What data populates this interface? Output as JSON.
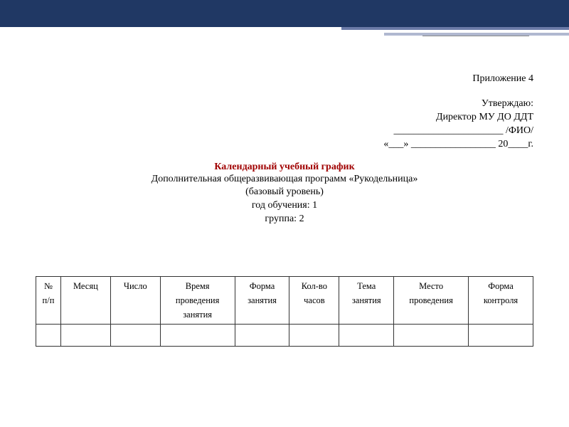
{
  "header": {
    "appendix": "Приложение 4"
  },
  "approve": {
    "line1": "Утверждаю:",
    "line2": "Директор МУ ДО ДДТ",
    "line3": "______________________ /ФИО/",
    "line4": "«___»  _________________ 20____г."
  },
  "title": {
    "main": "Календарный учебный график",
    "program": "Дополнительная общеразвивающая программ «Рукодельница»",
    "level": "(базовый уровень)",
    "year": "год обучения: 1",
    "group": "группа: 2"
  },
  "table": {
    "headers": [
      {
        "l1": "№",
        "l2": "п/п"
      },
      {
        "l1": "Месяц",
        "l2": ""
      },
      {
        "l1": "Число",
        "l2": ""
      },
      {
        "l1": "Время",
        "l2": "проведения",
        "l3": "занятия"
      },
      {
        "l1": "Форма",
        "l2": "занятия"
      },
      {
        "l1": "Кол-во",
        "l2": "часов"
      },
      {
        "l1": "Тема",
        "l2": "занятия"
      },
      {
        "l1": "Место",
        "l2": "проведения"
      },
      {
        "l1": "Форма",
        "l2": "контроля"
      }
    ]
  },
  "colwidths": [
    "5%",
    "10%",
    "10%",
    "15%",
    "11%",
    "10%",
    "11%",
    "15%",
    "13%"
  ]
}
